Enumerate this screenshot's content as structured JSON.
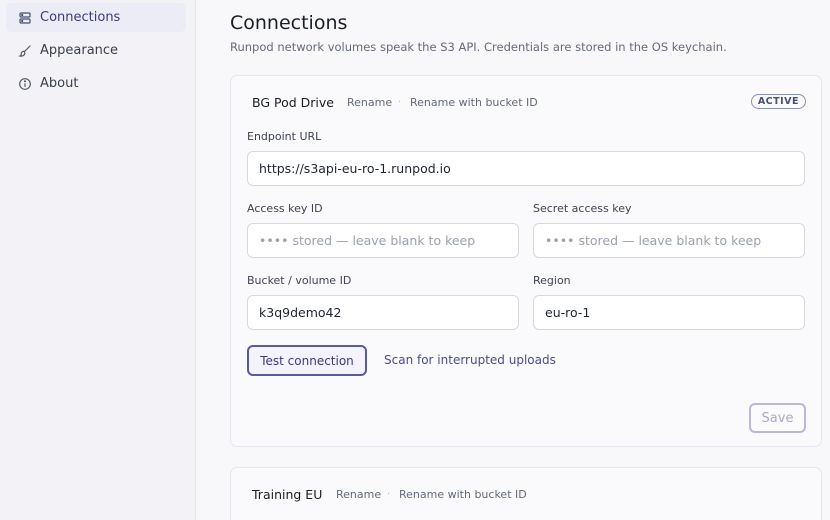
{
  "sidebar": {
    "items": [
      {
        "label": "Connections",
        "icon": "server-icon",
        "active": true
      },
      {
        "label": "Appearance",
        "icon": "brush-icon",
        "active": false
      },
      {
        "label": "About",
        "icon": "info-icon",
        "active": false
      }
    ]
  },
  "header": {
    "title": "Connections",
    "subtitle": "Runpod network volumes speak the S3 API. Credentials are stored in the OS keychain."
  },
  "connections": [
    {
      "name": "BG Pod Drive",
      "rename": "Rename",
      "rename_bucket": "Rename with bucket ID",
      "badge": "ACTIVE",
      "endpoint_label": "Endpoint URL",
      "endpoint_value": "https://s3api-eu-ro-1.runpod.io",
      "access_key_label": "Access key ID",
      "access_key_placeholder": "•••• stored — leave blank to keep",
      "secret_key_label": "Secret access key",
      "secret_key_placeholder": "•••• stored — leave blank to keep",
      "bucket_label": "Bucket / volume ID",
      "bucket_value": "k3q9demo42",
      "region_label": "Region",
      "region_value": "eu-ro-1",
      "test_button": "Test connection",
      "scan_link": "Scan for interrupted uploads",
      "save_button": "Save"
    },
    {
      "name": "Training EU",
      "rename": "Rename",
      "rename_bucket": "Rename with bucket ID"
    }
  ],
  "separator": "·",
  "colors": {
    "accent": "#5b5a9c",
    "active_nav_bg": "#ececf7",
    "badge_border": "#8a8fb8"
  }
}
